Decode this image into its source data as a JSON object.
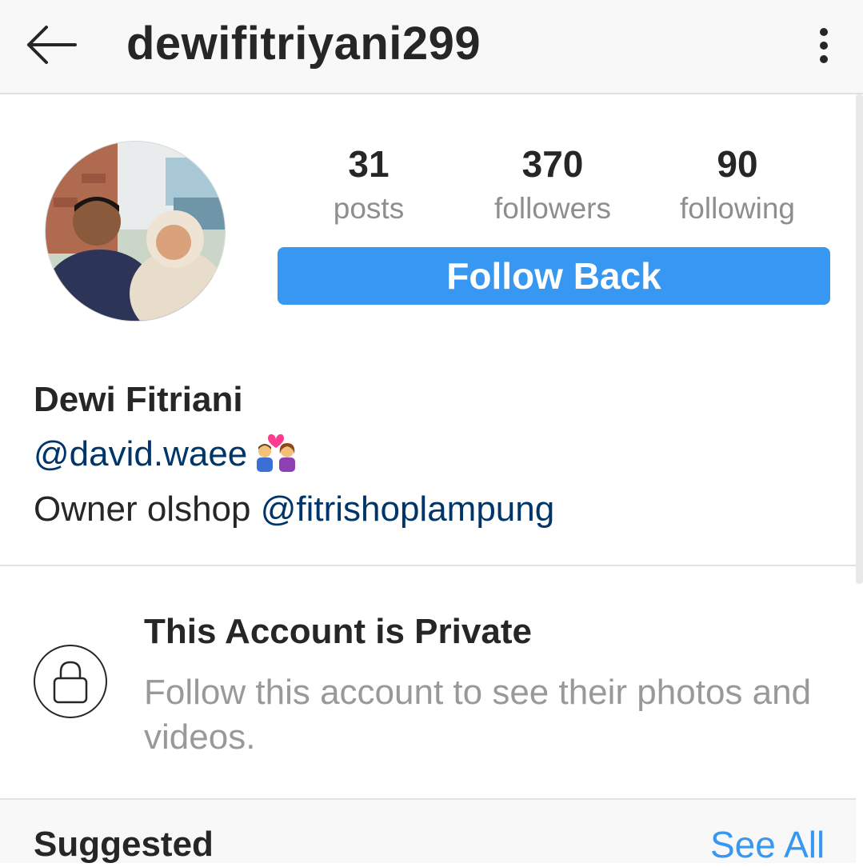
{
  "header": {
    "username": "dewifitriyani299",
    "back_icon": "arrow-left-icon",
    "more_icon": "vertical-dots-icon"
  },
  "profile": {
    "avatar_icon": "profile-photo",
    "stats": [
      {
        "value": "31",
        "label": "posts"
      },
      {
        "value": "370",
        "label": "followers"
      },
      {
        "value": "90",
        "label": "following"
      }
    ],
    "follow_button": "Follow Back"
  },
  "bio": {
    "name": "Dewi Fitriani",
    "mention": "@david.waee",
    "emoji": "couple-with-heart-emoji",
    "line2_prefix": "Owner olshop ",
    "line2_mention": "@fitrishoplampung"
  },
  "private": {
    "icon": "lock-icon",
    "title": "This Account is Private",
    "subtitle": "Follow this account to see their photos and videos."
  },
  "suggested": {
    "label": "Suggested",
    "see_all": "See All"
  },
  "colors": {
    "accent": "#3897f0",
    "link": "#003569",
    "muted": "#8e8e8e"
  }
}
